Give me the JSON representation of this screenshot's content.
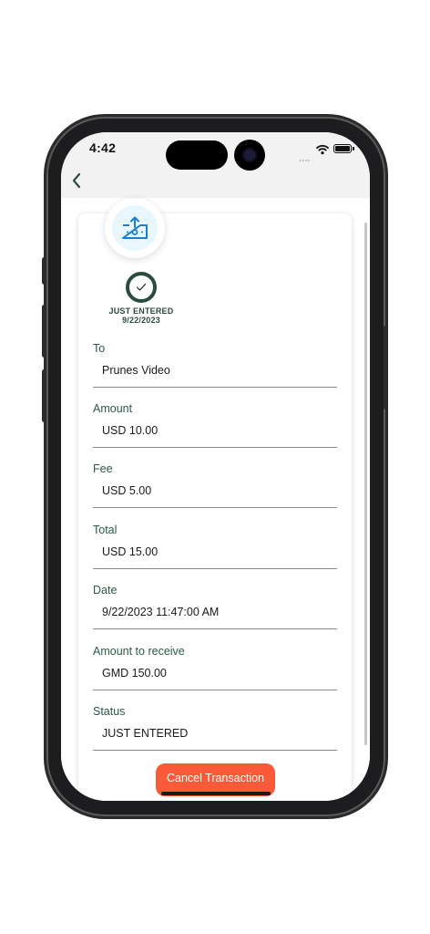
{
  "status_bar": {
    "time": "4:42"
  },
  "colors": {
    "accent_green": "#2b4b3c",
    "label_green": "#2b5a43",
    "cancel_orange": "#fa5a37",
    "badge_blue": "#1a7fd4"
  },
  "icons": {
    "back": "chevron-left-icon",
    "badge": "money-transfer-icon",
    "check": "checkmark-icon"
  },
  "progress": {
    "status": "JUST ENTERED",
    "date": "9/22/2023"
  },
  "fields": [
    {
      "label": "To",
      "value": "Prunes Video"
    },
    {
      "label": "Amount",
      "value": "USD 10.00"
    },
    {
      "label": "Fee",
      "value": "USD 5.00"
    },
    {
      "label": "Total",
      "value": "USD 15.00"
    },
    {
      "label": "Date",
      "value": "9/22/2023 11:47:00 AM"
    },
    {
      "label": "Amount to receive",
      "value": "GMD 150.00"
    },
    {
      "label": "Status",
      "value": "JUST ENTERED"
    }
  ],
  "actions": {
    "cancel_label": "Cancel Transaction"
  }
}
